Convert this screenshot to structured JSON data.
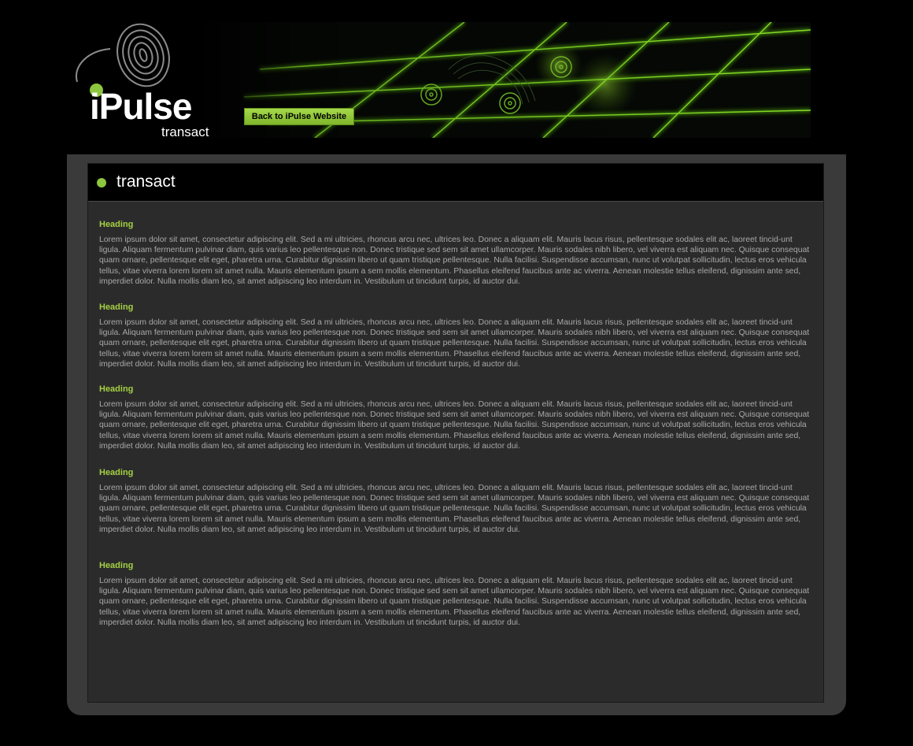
{
  "header": {
    "logo_word": "iPulse",
    "logo_sub": "transact",
    "back_button_label": "Back to iPulse Website"
  },
  "panel": {
    "title": "transact"
  },
  "sections": [
    {
      "heading": "Heading",
      "body": "Lorem ipsum dolor sit amet, consectetur adipiscing elit. Sed a mi ultricies, rhoncus arcu nec, ultrices leo. Donec a aliquam elit. Mauris lacus risus, pellentesque sodales elit ac, laoreet tincid-unt ligula. Aliquam fermentum pulvinar diam, quis varius leo pellentesque non. Donec tristique sed sem sit amet ullamcorper. Mauris sodales nibh libero, vel viverra est aliquam nec. Quisque consequat quam ornare, pellentesque elit eget, pharetra urna. Curabitur dignissim libero ut quam tristique pellentesque. Nulla facilisi. Suspendisse accumsan, nunc ut volutpat sollicitudin, lectus eros vehicula tellus, vitae viverra lorem lorem sit amet nulla. Mauris elementum ipsum a sem mollis elementum. Phasellus eleifend faucibus ante ac viverra. Aenean molestie tellus eleifend, dignissim ante sed, imperdiet dolor. Nulla mollis diam leo, sit amet adipiscing leo interdum in. Vestibulum ut tincidunt turpis, id auctor dui."
    },
    {
      "heading": "Heading",
      "body": "Lorem ipsum dolor sit amet, consectetur adipiscing elit. Sed a mi ultricies, rhoncus arcu nec, ultrices leo. Donec a aliquam elit. Mauris lacus risus, pellentesque sodales elit ac, laoreet tincid-unt ligula. Aliquam fermentum pulvinar diam, quis varius leo pellentesque non. Donec tristique sed sem sit amet ullamcorper. Mauris sodales nibh libero, vel viverra est aliquam nec. Quisque consequat quam ornare, pellentesque elit eget, pharetra urna. Curabitur dignissim libero ut quam tristique pellentesque. Nulla facilisi. Suspendisse accumsan, nunc ut volutpat sollicitudin, lectus eros vehicula tellus, vitae viverra lorem lorem sit amet nulla. Mauris elementum ipsum a sem mollis elementum. Phasellus eleifend faucibus ante ac viverra. Aenean molestie tellus eleifend, dignissim ante sed, imperdiet dolor. Nulla mollis diam leo, sit amet adipiscing leo interdum in. Vestibulum ut tincidunt turpis, id auctor dui."
    },
    {
      "heading": "Heading",
      "body": "Lorem ipsum dolor sit amet, consectetur adipiscing elit. Sed a mi ultricies, rhoncus arcu nec, ultrices leo. Donec a aliquam elit. Mauris lacus risus, pellentesque sodales elit ac, laoreet tincid-unt ligula. Aliquam fermentum pulvinar diam, quis varius leo pellentesque non. Donec tristique sed sem sit amet ullamcorper. Mauris sodales nibh libero, vel viverra est aliquam nec. Quisque consequat quam ornare, pellentesque elit eget, pharetra urna. Curabitur dignissim libero ut quam tristique pellentesque. Nulla facilisi. Suspendisse accumsan, nunc ut volutpat sollicitudin, lectus eros vehicula tellus, vitae viverra lorem lorem sit amet nulla. Mauris elementum ipsum a sem mollis elementum. Phasellus eleifend faucibus ante ac viverra. Aenean molestie tellus eleifend, dignissim ante sed, imperdiet dolor. Nulla mollis diam leo, sit amet adipiscing leo interdum in. Vestibulum ut tincidunt turpis, id auctor dui."
    },
    {
      "heading": "Heading",
      "body": "Lorem ipsum dolor sit amet, consectetur adipiscing elit. Sed a mi ultricies, rhoncus arcu nec, ultrices leo. Donec a aliquam elit. Mauris lacus risus, pellentesque sodales elit ac, laoreet tincid-unt ligula. Aliquam fermentum pulvinar diam, quis varius leo pellentesque non. Donec tristique sed sem sit amet ullamcorper. Mauris sodales nibh libero, vel viverra est aliquam nec. Quisque consequat quam ornare, pellentesque elit eget, pharetra urna. Curabitur dignissim libero ut quam tristique pellentesque. Nulla facilisi. Suspendisse accumsan, nunc ut volutpat sollicitudin, lectus eros vehicula tellus, vitae viverra lorem lorem sit amet nulla. Mauris elementum ipsum a sem mollis elementum. Phasellus eleifend faucibus ante ac viverra. Aenean molestie tellus eleifend, dignissim ante sed, imperdiet dolor. Nulla mollis diam leo, sit amet adipiscing leo interdum in. Vestibulum ut tincidunt turpis, id auctor dui."
    },
    {
      "heading": "Heading",
      "body": "Lorem ipsum dolor sit amet, consectetur adipiscing elit. Sed a mi ultricies, rhoncus arcu nec, ultrices leo. Donec a aliquam elit. Mauris lacus risus, pellentesque sodales elit ac, laoreet tincid-unt ligula. Aliquam fermentum pulvinar diam, quis varius leo pellentesque non. Donec tristique sed sem sit amet ullamcorper. Mauris sodales nibh libero, vel viverra est aliquam nec. Quisque consequat quam ornare, pellentesque elit eget, pharetra urna. Curabitur dignissim libero ut quam tristique pellentesque. Nulla facilisi. Suspendisse accumsan, nunc ut volutpat sollicitudin, lectus eros vehicula tellus, vitae viverra lorem lorem sit amet nulla. Mauris elementum ipsum a sem mollis elementum. Phasellus eleifend faucibus ante ac viverra. Aenean molestie tellus eleifend, dignissim ante sed, imperdiet dolor. Nulla mollis diam leo, sit amet adipiscing leo interdum in. Vestibulum ut tincidunt turpis, id auctor dui."
    }
  ],
  "colors": {
    "accent_green": "#8dc63f",
    "heading_green": "#a4d143",
    "panel_outer": "#3b3a3a",
    "panel_inner": "#2c2b2b",
    "body_text": "#a9a9a9"
  }
}
